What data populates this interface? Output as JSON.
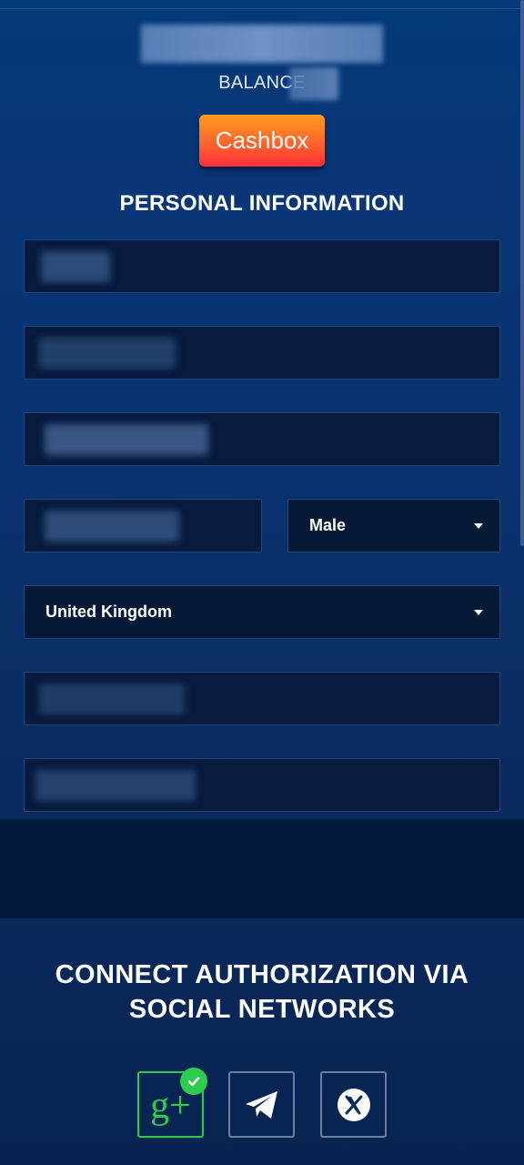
{
  "account": {
    "balance_label": "BALANCE",
    "cashbox_label": "Cashbox"
  },
  "personal": {
    "title": "PERSONAL INFORMATION",
    "gender": "Male",
    "country": "United Kingdom"
  },
  "social": {
    "title": "CONNECT AUTHORIZATION VIA SOCIAL NETWORKS",
    "networks": [
      {
        "name": "google-plus",
        "icon": "google-plus-icon",
        "connected": true
      },
      {
        "name": "telegram",
        "icon": "telegram-icon",
        "connected": false
      },
      {
        "name": "x",
        "icon": "x-icon",
        "connected": false
      }
    ]
  },
  "colors": {
    "accent_orange": "#ff6a2a",
    "connected_green": "#2ecc4e",
    "background_blue": "#0a3270"
  }
}
